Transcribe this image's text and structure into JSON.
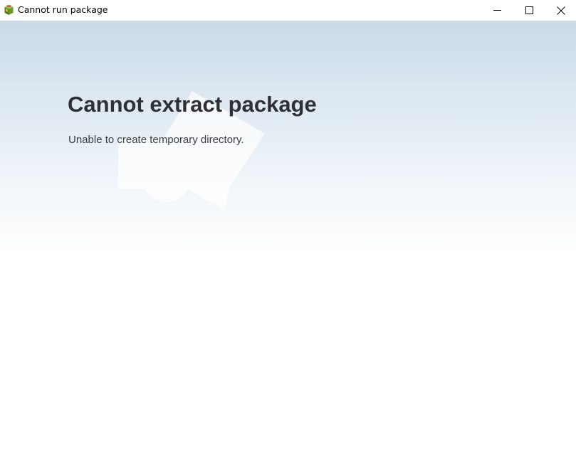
{
  "window": {
    "title": "Cannot run package",
    "app_icon": "package-box-icon"
  },
  "controls": {
    "minimize_icon": "minimize-icon",
    "maximize_icon": "maximize-icon",
    "close_icon": "close-icon"
  },
  "content": {
    "heading": "Cannot extract package",
    "message": "Unable to create temporary directory.",
    "watermark_icon": "package-watermark-icon"
  },
  "colors": {
    "gradient_top": "#c9dbe8",
    "gradient_bottom": "#ffffff",
    "heading_text": "#2e3033",
    "body_text": "#3a3d40"
  }
}
